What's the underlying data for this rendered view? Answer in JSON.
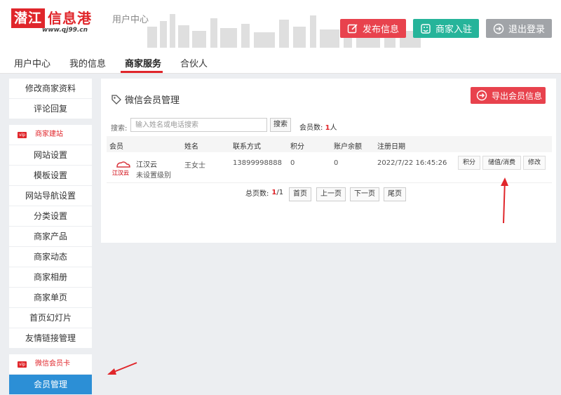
{
  "logo": {
    "mark": "潜江",
    "text": "信息港",
    "url": "www.qj99.cn"
  },
  "header": {
    "subtitle": "用户中心",
    "buttons": {
      "publish": "发布信息",
      "join": "商家入驻",
      "logout": "退出登录"
    }
  },
  "tabs": [
    "用户中心",
    "我的信息",
    "商家服务",
    "合伙人"
  ],
  "active_tab": "商家服务",
  "sidebar": {
    "top_items": [
      "修改商家资料",
      "评论回复"
    ],
    "section1": {
      "tag": "vip",
      "title": "商家建站",
      "items": [
        "网站设置",
        "模板设置",
        "网站导航设置",
        "分类设置",
        "商家产品",
        "商家动态",
        "商家相册",
        "商家单页",
        "首页幻灯片",
        "友情链接管理"
      ]
    },
    "section2": {
      "tag": "vip",
      "title": "微信会员卡",
      "items": [
        "会员管理"
      ]
    }
  },
  "panel": {
    "title": "微信会员管理",
    "export_label": "导出会员信息",
    "search_label": "搜索:",
    "search_placeholder": "输入姓名或电话搜索",
    "search_button": "搜索",
    "count_label": "会员数:",
    "count_value": "1",
    "count_unit": "人",
    "columns": [
      "会员",
      "姓名",
      "联系方式",
      "积分",
      "账户余额",
      "注册日期"
    ],
    "rows": [
      {
        "member_name": "江汉云",
        "member_level": "未设置级别",
        "avatar_text": "江汉云",
        "name": "王女士",
        "phone": "13899998888",
        "points": "0",
        "balance": "0",
        "reg_date": "2022/7/22 16:45:26",
        "actions": [
          "积分",
          "储值/消费",
          "修改"
        ]
      }
    ],
    "pager": {
      "total_label": "总页数:",
      "current": "1",
      "total": "/1",
      "first": "首页",
      "prev": "上一页",
      "next": "下一页",
      "last": "尾页"
    }
  },
  "colors": {
    "brand_red": "#e0262b",
    "btn_red": "#e8424d",
    "btn_green": "#26b49a",
    "btn_gray": "#a1a4a8",
    "active_blue": "#2c8fd6"
  },
  "icons": {
    "publish": "edit-icon",
    "join": "store-icon",
    "logout": "logout-arrow-icon",
    "panel_title": "tag-icon",
    "export": "export-arrow-icon"
  }
}
